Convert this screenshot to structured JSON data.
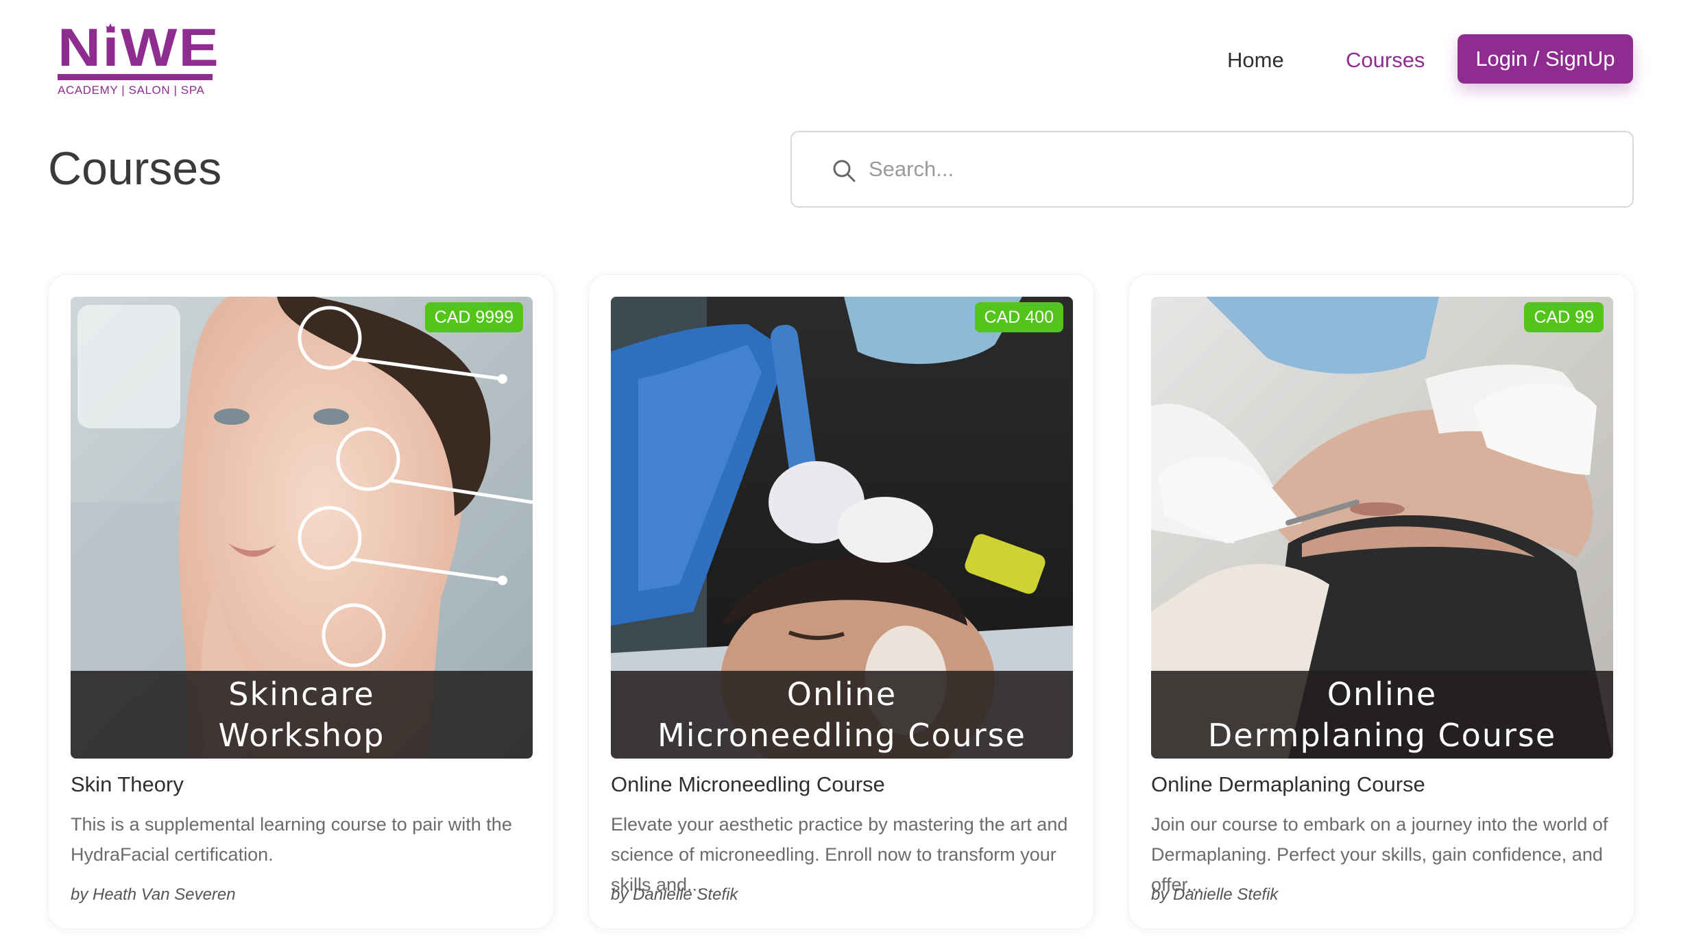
{
  "header": {
    "logo": {
      "word": "NiWE",
      "tagline": "ACADEMY | SALON | SPA"
    },
    "nav": {
      "home": "Home",
      "courses": "Courses",
      "login": "Login / SignUp"
    }
  },
  "main": {
    "title": "Courses",
    "search": {
      "placeholder": "Search..."
    },
    "courses": [
      {
        "price": "CAD 9999",
        "overlay_line1": "Skincare",
        "overlay_line2": "Workshop",
        "title": "Skin Theory",
        "description": "This is a supplemental learning course to pair with the HydraFacial certification.",
        "author": "by Heath Van Severen"
      },
      {
        "price": "CAD 400",
        "overlay_line1": "Online",
        "overlay_line2": "Microneedling Course",
        "title": "Online Microneedling Course",
        "description": "Elevate your aesthetic practice by mastering the art and science of microneedling. Enroll now to transform your skills and...",
        "author": "by Danielle Stefik"
      },
      {
        "price": "CAD 99",
        "overlay_line1": "Online",
        "overlay_line2": "Dermplaning Course",
        "title": "Online Dermaplaning Course",
        "description": "Join our course to embark on a journey into the world of Dermaplaning. Perfect your skills, gain confidence, and offer...",
        "author": "by Danielle Stefik"
      }
    ]
  },
  "colors": {
    "brand": "#8e2d8f",
    "price_badge": "#52c41a",
    "overlay": "#231e1e"
  },
  "icons": {
    "search": "search-icon",
    "logo_leaf": "maple-leaf-icon"
  }
}
